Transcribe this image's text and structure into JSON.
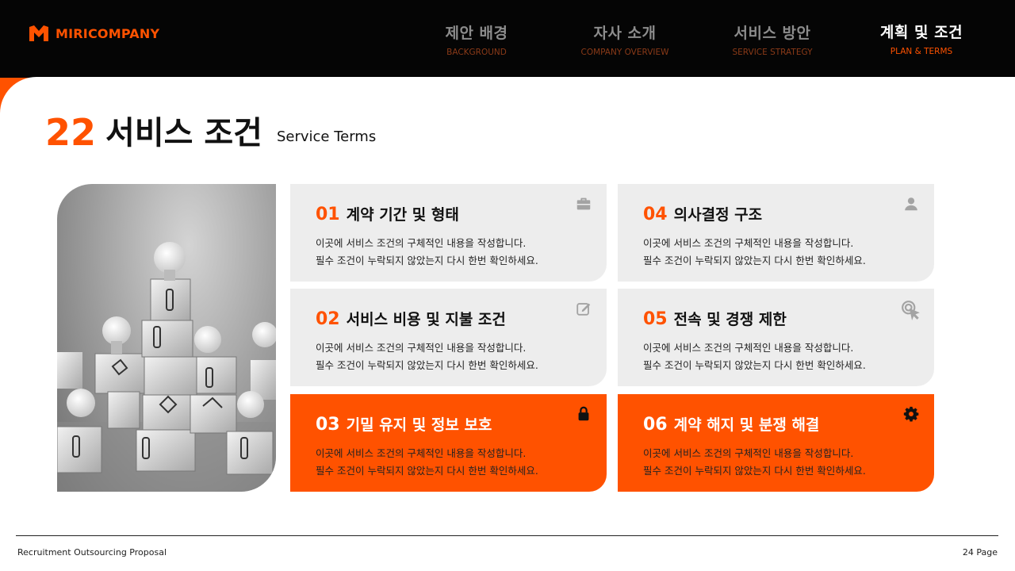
{
  "brand": {
    "name": "MIRICOMPANY",
    "accent": "#ff5200",
    "logo_icon": "m-logo-icon"
  },
  "nav": [
    {
      "ko": "제안 배경",
      "en": "BACKGROUND",
      "active": false
    },
    {
      "ko": "자사 소개",
      "en": "COMPANY OVERVIEW",
      "active": false
    },
    {
      "ko": "서비스 방안",
      "en": "SERVICE STRATEGY",
      "active": false
    },
    {
      "ko": "계획 및 조건",
      "en": "PLAN & TERMS",
      "active": true
    }
  ],
  "title": {
    "number": "22",
    "ko": "서비스 조건",
    "en": "Service Terms"
  },
  "photo": {
    "icon": "light-bulb-blocks-image"
  },
  "cards": [
    {
      "number": "01",
      "title": "계약 기간 및 형태",
      "line1": "이곳에 서비스 조건의 구체적인 내용을 작성합니다.",
      "line2": "필수 조건이 누락되지 않았는지 다시 한번 확인하세요.",
      "icon": "briefcase-icon",
      "highlight": false
    },
    {
      "number": "02",
      "title": "서비스 비용 및 지불 조건",
      "line1": "이곳에 서비스 조건의 구체적인 내용을 작성합니다.",
      "line2": "필수 조건이 누락되지 않았는지 다시 한번 확인하세요.",
      "icon": "edit-icon",
      "highlight": false
    },
    {
      "number": "03",
      "title": "기밀 유지 및 정보 보호",
      "line1": "이곳에 서비스 조건의 구체적인 내용을 작성합니다.",
      "line2": "필수 조건이 누락되지 않았는지 다시 한번 확인하세요.",
      "icon": "lock-icon",
      "highlight": true
    },
    {
      "number": "04",
      "title": "의사결정 구조",
      "line1": "이곳에 서비스 조건의 구체적인 내용을 작성합니다.",
      "line2": "필수 조건이 누락되지 않았는지 다시 한번 확인하세요.",
      "icon": "person-icon",
      "highlight": false
    },
    {
      "number": "05",
      "title": "전속 및 경쟁 제한",
      "line1": "이곳에 서비스 조건의 구체적인 내용을 작성합니다.",
      "line2": "필수 조건이 누락되지 않았는지 다시 한번 확인하세요.",
      "icon": "cursor-click-icon",
      "highlight": false
    },
    {
      "number": "06",
      "title": "계약 해지 및 분쟁 해결",
      "line1": "이곳에 서비스 조건의 구체적인 내용을 작성합니다.",
      "line2": "필수 조건이 누락되지 않았는지 다시 한번 확인하세요.",
      "icon": "gear-icon",
      "highlight": true
    }
  ],
  "footer": {
    "left": "Recruitment Outsourcing Proposal",
    "right": "24 Page"
  }
}
